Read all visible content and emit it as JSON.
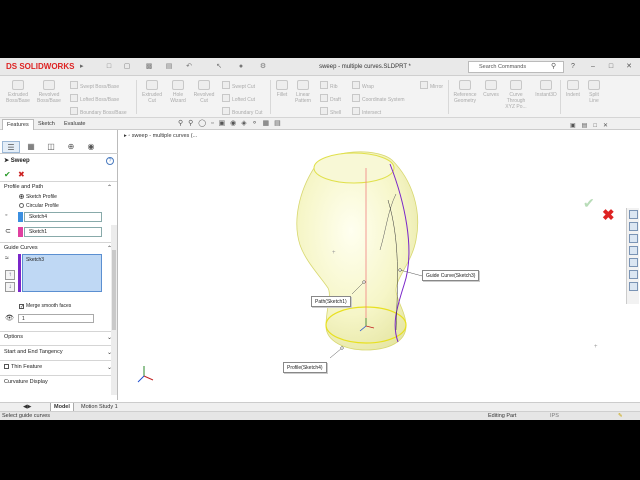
{
  "app": {
    "logo": "DS SOLIDWORKS",
    "document_title": "sweep - multiple curves.SLDPRT *",
    "search_placeholder": "Search Commands"
  },
  "command_manager": {
    "large": [
      {
        "label1": "Extruded",
        "label2": "Boss/Base"
      },
      {
        "label1": "Revolved",
        "label2": "Boss/Base"
      },
      {
        "label1": "Extruded",
        "label2": "Cut"
      },
      {
        "label1": "Hole",
        "label2": "Wizard"
      },
      {
        "label1": "Revolved",
        "label2": "Cut"
      },
      {
        "label1": "Fillet",
        "label2": ""
      },
      {
        "label1": "Linear",
        "label2": "Pattern"
      },
      {
        "label1": "Reference",
        "label2": "Geometry"
      },
      {
        "label1": "Curves",
        "label2": ""
      },
      {
        "label1": "Curve",
        "label2": "Through XYZ Po..."
      },
      {
        "label1": "Instant3D",
        "label2": ""
      },
      {
        "label1": "Indent",
        "label2": ""
      },
      {
        "label1": "Split",
        "label2": "Line"
      }
    ],
    "small": [
      "Swept Boss/Base",
      "Lofted Boss/Base",
      "Boundary Boss/Base",
      "Swept Cut",
      "Lofted Cut",
      "Boundary Cut",
      "Rib",
      "Draft",
      "Shell",
      "Wrap",
      "Coordinate System",
      "Intersect",
      "Mirror"
    ]
  },
  "tabs": [
    "Features",
    "Sketch",
    "Evaluate"
  ],
  "property_manager": {
    "title": "Sweep",
    "profile_and_path": {
      "header": "Profile and Path",
      "option_sketch_profile": "Sketch Profile",
      "option_circular_profile": "Circular Profile",
      "profile_value": "Sketch4",
      "path_value": "Sketch1"
    },
    "guide_curves": {
      "header": "Guide Curves",
      "items": [
        "Sketch3"
      ],
      "merge_smooth_faces": "Merge smooth faces",
      "spin_value": "1"
    },
    "sections": [
      "Options",
      "Start and End Tangency",
      "Thin Feature",
      "Curvature Display"
    ],
    "colors": {
      "profile": "#3b8fe0",
      "path": "#e040a0",
      "guide": "#7a26c9"
    }
  },
  "viewport": {
    "tree_flyout": "sweep - multiple curves (...",
    "callouts": {
      "guide": "Guide Curve(Sketch3)",
      "path": "Path(Sketch1)",
      "profile": "Profile(Sketch4)"
    }
  },
  "bottom_tabs": [
    "Model",
    "Motion Study 1"
  ],
  "status": {
    "message": "Select guide curves",
    "mode": "Editing Part",
    "units": "IPS"
  }
}
